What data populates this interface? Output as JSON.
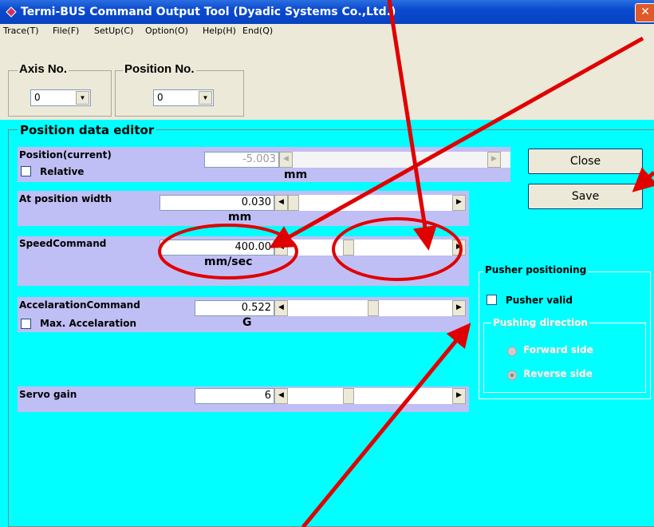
{
  "window": {
    "title": "Termi-BUS Command Output Tool (Dyadic Systems Co.,Ltd.)",
    "close_glyph": "✕"
  },
  "menu": [
    "Trace(T)",
    "File(F)",
    "SetUp(C)",
    "Option(O)",
    "Help(H)",
    "End(Q)"
  ],
  "axis": {
    "label": "Axis No.",
    "value": "0"
  },
  "position_no": {
    "label": "Position No.",
    "value": "0"
  },
  "editor": {
    "title": "Position data editor",
    "position_current": {
      "label": "Position(current)",
      "value": "-5.003",
      "unit": "mm",
      "relative_label": "Relative"
    },
    "at_position_width": {
      "label": "At position width",
      "value": "0.030",
      "unit": "mm"
    },
    "speed_command": {
      "label": "SpeedCommand",
      "value": "400.00",
      "unit": "mm/sec",
      "slider_level": 0.36
    },
    "acceleration_command": {
      "label": "AccelarationCommand",
      "value": "0.522",
      "unit": "G",
      "max_label": "Max. Accelaration",
      "slider_level": 0.52
    },
    "servo_gain": {
      "label": "Servo gain",
      "value": "6",
      "slider_level": 0.36
    }
  },
  "buttons": {
    "close": "Close",
    "save": "Save"
  },
  "pusher": {
    "title": "Pusher positioning",
    "valid_label": "Pusher valid",
    "direction_title": "Pushing direction",
    "forward": "Forward side",
    "reverse": "Reverse side"
  },
  "colors": {
    "editor_bg": "#00ffff",
    "band": "#bfbff5",
    "annotation": "#e00000",
    "titlebar": "#0a4ad0"
  }
}
